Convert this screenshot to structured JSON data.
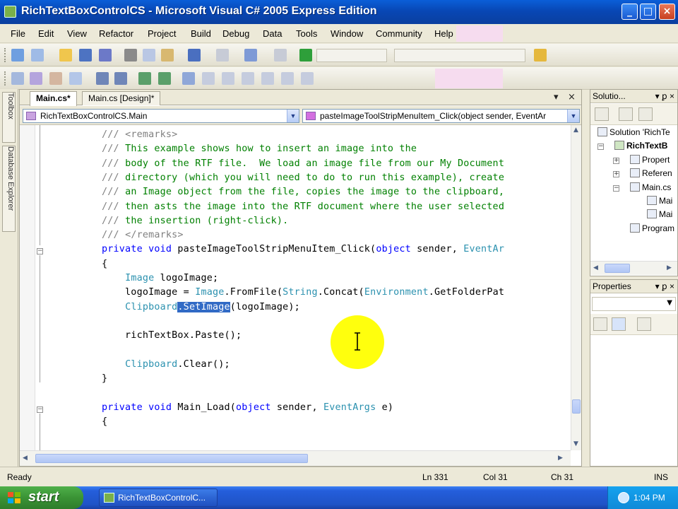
{
  "window": {
    "title": "RichTextBoxControlCS - Microsoft Visual C# 2005 Express Edition",
    "minimize_label": "_",
    "maximize_label": "□",
    "close_label": "×"
  },
  "menu": {
    "items": [
      "File",
      "Edit",
      "View",
      "Refactor",
      "Project",
      "Build",
      "Debug",
      "Data",
      "Tools",
      "Window",
      "Community",
      "Help"
    ]
  },
  "left_tabs": {
    "toolbox": "Toolbox",
    "database_explorer": "Database Explorer"
  },
  "editor": {
    "tabs": [
      "Main.cs*",
      "Main.cs [Design]*"
    ],
    "tab_menu_icon": "▾",
    "tab_close_icon": "×",
    "nav_type": "RichTextBoxControlCS.Main",
    "nav_member": "pasteImageToolStripMenuItem_Click(object sender, EventAr",
    "code_lines": [
      [
        {
          "t": "/// ",
          "c": "xml"
        },
        {
          "t": "<remarks>",
          "c": "xml"
        }
      ],
      [
        {
          "t": "/// ",
          "c": "xml"
        },
        {
          "t": "This example shows how to insert an image into the",
          "c": "comment"
        }
      ],
      [
        {
          "t": "/// ",
          "c": "xml"
        },
        {
          "t": "body of the RTF file.  We load an image file from our My Document",
          "c": "comment"
        }
      ],
      [
        {
          "t": "/// ",
          "c": "xml"
        },
        {
          "t": "directory (which you will need to do to run this example), create",
          "c": "comment"
        }
      ],
      [
        {
          "t": "/// ",
          "c": "xml"
        },
        {
          "t": "an Image object from the file, copies the image to the clipboard,",
          "c": "comment"
        }
      ],
      [
        {
          "t": "/// ",
          "c": "xml"
        },
        {
          "t": "then asts the image into the RTF document where the user selected",
          "c": "comment"
        }
      ],
      [
        {
          "t": "/// ",
          "c": "xml"
        },
        {
          "t": "the insertion (right-click).",
          "c": "comment"
        }
      ],
      [
        {
          "t": "/// ",
          "c": "xml"
        },
        {
          "t": "</remarks>",
          "c": "xml"
        }
      ],
      [
        {
          "t": "private void ",
          "c": "kw"
        },
        {
          "t": "pasteImageToolStripMenuItem_Click(",
          "c": ""
        },
        {
          "t": "object",
          "c": "kw"
        },
        {
          "t": " sender, ",
          "c": ""
        },
        {
          "t": "EventAr",
          "c": "type"
        }
      ],
      [
        {
          "t": "{",
          "c": ""
        }
      ],
      [
        {
          "t": "    ",
          "c": ""
        },
        {
          "t": "Image",
          "c": "type"
        },
        {
          "t": " logoImage;",
          "c": ""
        }
      ],
      [
        {
          "t": "    logoImage = ",
          "c": ""
        },
        {
          "t": "Image",
          "c": "type"
        },
        {
          "t": ".FromFile(",
          "c": ""
        },
        {
          "t": "String",
          "c": "type"
        },
        {
          "t": ".Concat(",
          "c": ""
        },
        {
          "t": "Environment",
          "c": "type"
        },
        {
          "t": ".GetFolderPat",
          "c": ""
        }
      ],
      [
        {
          "t": "    ",
          "c": ""
        },
        {
          "t": "Clipboard",
          "c": "type"
        },
        {
          "t": ".SetImage",
          "c": "sel"
        },
        {
          "t": "(logoImage);",
          "c": ""
        }
      ],
      [
        {
          "t": "",
          "c": ""
        }
      ],
      [
        {
          "t": "    richTextBox.Paste();",
          "c": ""
        }
      ],
      [
        {
          "t": "",
          "c": ""
        }
      ],
      [
        {
          "t": "    ",
          "c": ""
        },
        {
          "t": "Clipboard",
          "c": "type"
        },
        {
          "t": ".Clear();",
          "c": ""
        }
      ],
      [
        {
          "t": "}",
          "c": ""
        }
      ],
      [
        {
          "t": "",
          "c": ""
        }
      ],
      [
        {
          "t": "private void ",
          "c": "kw"
        },
        {
          "t": "Main_Load(",
          "c": ""
        },
        {
          "t": "object",
          "c": "kw"
        },
        {
          "t": " sender, ",
          "c": ""
        },
        {
          "t": "EventArgs",
          "c": "type"
        },
        {
          "t": " e)",
          "c": ""
        }
      ],
      [
        {
          "t": "{",
          "c": ""
        }
      ]
    ]
  },
  "solution_explorer": {
    "title": "Solutio...",
    "pin_icon": "▾ ꝑ ×",
    "items": [
      {
        "label": "Solution 'RichTe",
        "bold": false
      },
      {
        "label": "RichTextB",
        "bold": true
      },
      {
        "label": "Propert",
        "bold": false
      },
      {
        "label": "Referen",
        "bold": false
      },
      {
        "label": "Main.cs",
        "bold": false
      },
      {
        "label": "Mai",
        "bold": false
      },
      {
        "label": "Mai",
        "bold": false
      },
      {
        "label": "Program",
        "bold": false
      }
    ]
  },
  "properties": {
    "title": "Properties",
    "pin_icon": "▾ ꝑ ×"
  },
  "status": {
    "ready": "Ready",
    "ln": "Ln 331",
    "col": "Col 31",
    "ch": "Ch 31",
    "ins": "INS"
  },
  "taskbar": {
    "start_label": "start",
    "task_label": "RichTextBoxControlC...",
    "clock": "1:04 PM"
  },
  "colors": {
    "comment": "#008000",
    "keyword": "#0000ff",
    "type": "#2b91af",
    "selection": "#316ac5",
    "xp_blue": "#0a5fd8",
    "start_green": "#3a9335",
    "cursor_highlight": "#ffff00"
  }
}
